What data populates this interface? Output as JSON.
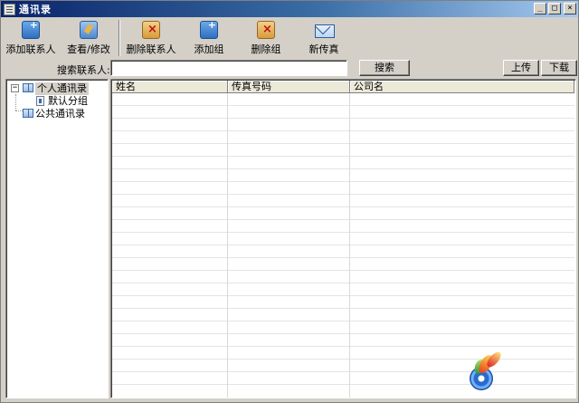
{
  "window": {
    "title": "通讯录",
    "minimize_glyph": "_",
    "maximize_glyph": "□",
    "close_glyph": "×"
  },
  "toolbar": {
    "add_contact": "添加联系人",
    "view_edit": "查看/修改",
    "delete_contact": "删除联系人",
    "add_group": "添加组",
    "delete_group": "删除组",
    "new_fax": "新传真"
  },
  "search": {
    "label": "搜索联系人:",
    "value": "",
    "button": "搜索",
    "upload": "上传",
    "download": "下载"
  },
  "tree": {
    "personal": {
      "label": "个人通讯录",
      "expander": "−"
    },
    "default_group": {
      "label": "默认分组"
    },
    "public": {
      "label": "公共通讯录"
    }
  },
  "grid": {
    "columns": [
      "姓名",
      "传真号码",
      "公司名"
    ]
  },
  "icons": {
    "add_contact": "add-contact-icon",
    "view_edit": "edit-contact-icon",
    "delete_contact": "delete-contact-icon",
    "add_group": "add-group-icon",
    "delete_group": "delete-group-icon",
    "new_fax": "new-fax-icon"
  },
  "colors": {
    "titlebar_start": "#0a246a",
    "titlebar_end": "#a6caf0",
    "window_bg": "#d4d0c8"
  }
}
